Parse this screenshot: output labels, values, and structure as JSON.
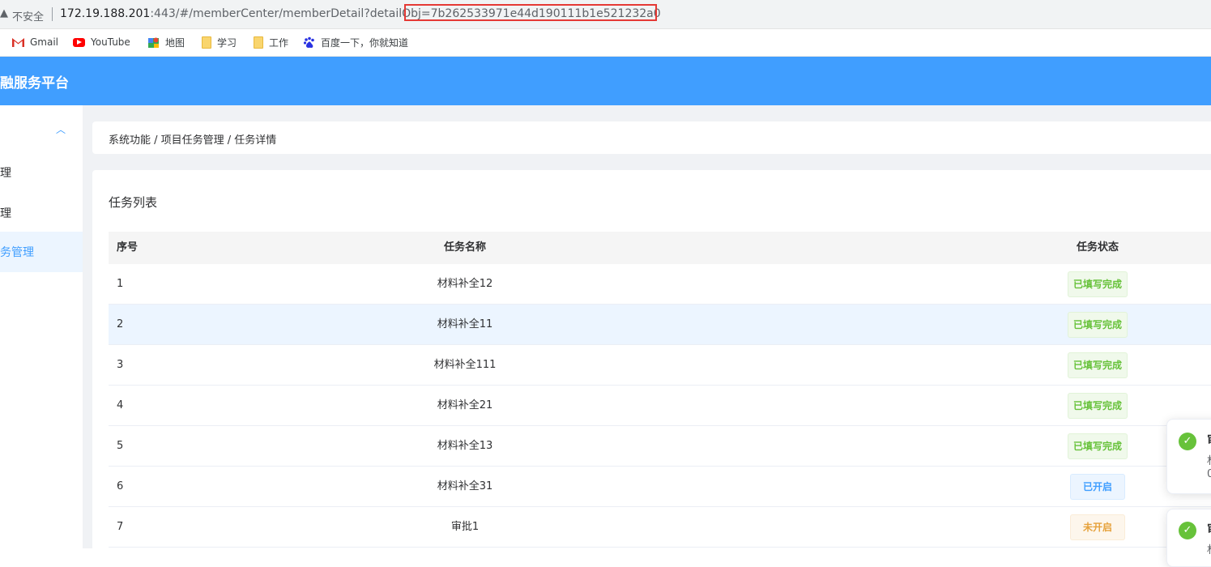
{
  "browser": {
    "insecure_label": "不安全",
    "url_host": "172.19.188.201",
    "url_rest": ":443/#/memberCenter/memberDetail?detailObj=7b262533971e44d190111b1e521232a0",
    "bookmarks": [
      {
        "label": "Gmail",
        "icon": "gmail-icon"
      },
      {
        "label": "YouTube",
        "icon": "youtube-icon"
      },
      {
        "label": "地图",
        "icon": "maps-icon"
      },
      {
        "label": "学习",
        "icon": "folder-icon"
      },
      {
        "label": "工作",
        "icon": "folder-icon"
      },
      {
        "label": "百度一下，你就知道",
        "icon": "baidu-icon"
      }
    ]
  },
  "header": {
    "title": "融服务平台"
  },
  "sidebar": {
    "items": [
      {
        "label": "理"
      },
      {
        "label": "理"
      },
      {
        "label": "务管理"
      }
    ]
  },
  "breadcrumb": "系统功能 / 项目任务管理 / 任务详情",
  "section_title": "任务列表",
  "table": {
    "headers": [
      "序号",
      "任务名称",
      "任务状态"
    ],
    "rows": [
      {
        "idx": "1",
        "name": "材料补全12",
        "status": "已填写完成"
      },
      {
        "idx": "2",
        "name": "材料补全11",
        "status": "已填写完成"
      },
      {
        "idx": "3",
        "name": "材料补全111",
        "status": "已填写完成"
      },
      {
        "idx": "4",
        "name": "材料补全21",
        "status": "已填写完成"
      },
      {
        "idx": "5",
        "name": "材料补全13",
        "status": "已填写完成"
      },
      {
        "idx": "6",
        "name": "材料补全31",
        "status": "已开启"
      },
      {
        "idx": "7",
        "name": "审批1",
        "status": "未开启"
      }
    ]
  },
  "notifications": [
    {
      "title": "审",
      "line1": "材",
      "line2": "0"
    },
    {
      "title": "审",
      "line1": "材"
    }
  ],
  "colors": {
    "primary": "#409eff",
    "success": "#67c23a",
    "warning": "#e6a23c",
    "highlight_box": "#e53935"
  }
}
